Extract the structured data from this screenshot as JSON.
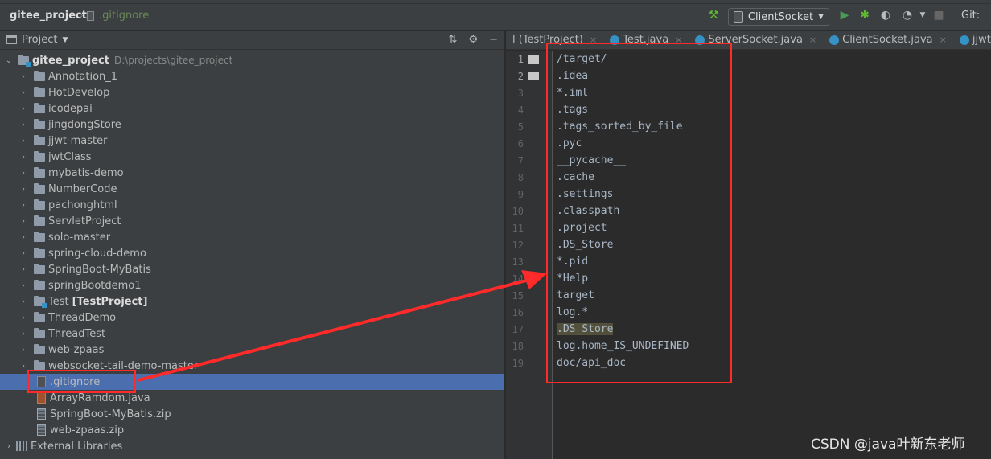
{
  "breadcrumb": {
    "project": "gitee_project",
    "file": ".gitignore"
  },
  "toolbar": {
    "run_config": "ClientSocket",
    "git_label": "Git:",
    "icons": [
      "hammer-icon",
      "run-icon",
      "debug-icon",
      "coverage-icon",
      "profile-icon",
      "stop-icon"
    ]
  },
  "project_panel": {
    "title": "Project",
    "root": {
      "name": "gitee_project",
      "path": "D:\\projects\\gitee_project"
    },
    "folders": [
      {
        "name": "Annotation_1"
      },
      {
        "name": "HotDevelop"
      },
      {
        "name": "icodepai"
      },
      {
        "name": "jingdongStore"
      },
      {
        "name": "jjwt-master"
      },
      {
        "name": "jwtClass"
      },
      {
        "name": "mybatis-demo"
      },
      {
        "name": "NumberCode"
      },
      {
        "name": "pachonghtml"
      },
      {
        "name": "ServletProject"
      },
      {
        "name": "solo-master"
      },
      {
        "name": "spring-cloud-demo"
      },
      {
        "name": "SpringBoot-MyBatis"
      },
      {
        "name": "springBootdemo1"
      },
      {
        "name": "Test",
        "suffix": "[TestProject]"
      },
      {
        "name": "ThreadDemo"
      },
      {
        "name": "ThreadTest"
      },
      {
        "name": "web-zpaas"
      },
      {
        "name": "websocket-tail-demo-master"
      }
    ],
    "files": [
      {
        "name": ".gitignore",
        "kind": "git"
      },
      {
        "name": "ArrayRamdom.java",
        "kind": "java"
      },
      {
        "name": "SpringBoot-MyBatis.zip",
        "kind": "zip"
      },
      {
        "name": "web-zpaas.zip",
        "kind": "zip"
      }
    ],
    "external_libraries": "External Libraries"
  },
  "editor": {
    "tabs": [
      {
        "label": "l (TestProject)"
      },
      {
        "label": "Test.java"
      },
      {
        "label": "ServerSocket.java"
      },
      {
        "label": "ClientSocket.java"
      },
      {
        "label": "jjwt-master\\"
      }
    ],
    "lines": [
      "/target/",
      ".idea",
      "*.iml",
      ".tags",
      ".tags_sorted_by_file",
      ".pyc",
      "__pycache__",
      ".cache",
      ".settings",
      ".classpath",
      ".project",
      ".DS_Store",
      "*.pid",
      "*Help",
      "target",
      "log.*",
      ".DS_Store",
      "log.home_IS_UNDEFINED",
      "doc/api_doc"
    ],
    "line_numbers": [
      "1",
      "2",
      "3",
      "4",
      "5",
      "6",
      "7",
      "8",
      "9",
      "10",
      "11",
      "12",
      "13",
      "14",
      "15",
      "16",
      "17",
      "18",
      "19"
    ]
  },
  "watermark": "CSDN @java叶新东老师",
  "colors": {
    "annotation": "#ff2a2a",
    "selection": "#4b6eaf"
  }
}
